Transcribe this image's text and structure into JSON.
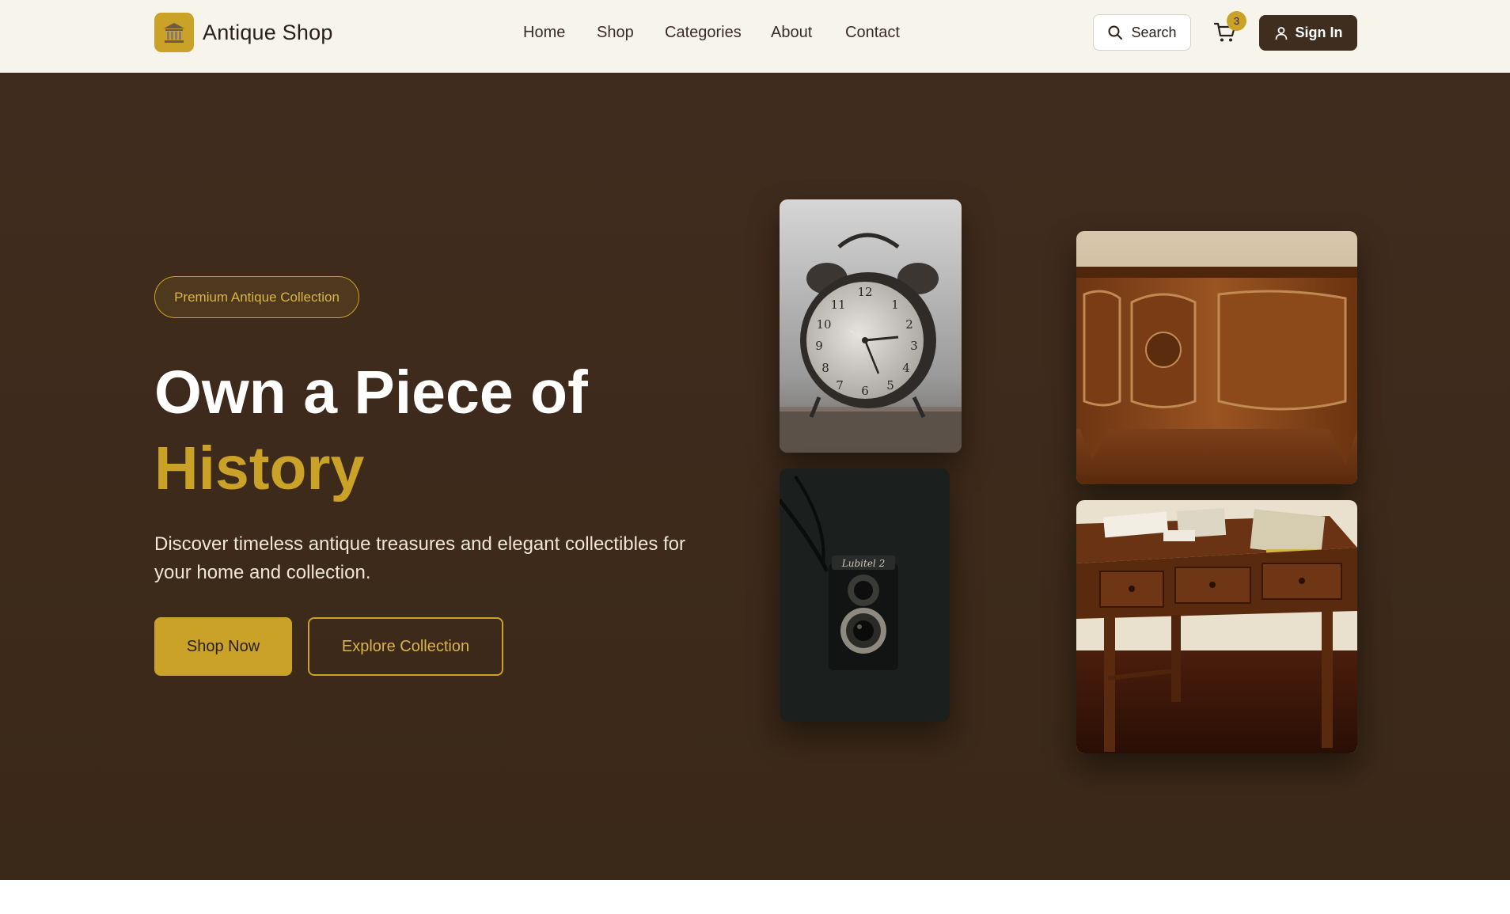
{
  "header": {
    "brand_name": "Antique Shop",
    "brand_icon": "museum-icon",
    "nav": [
      {
        "label": "Home"
      },
      {
        "label": "Shop"
      },
      {
        "label": "Categories"
      },
      {
        "label": "About"
      },
      {
        "label": "Contact"
      }
    ],
    "search_label": "Search",
    "cart_count": "3",
    "signin_label": "Sign In"
  },
  "hero": {
    "badge": "Premium Antique Collection",
    "headline": "Own a Piece of",
    "headline_accent": "History",
    "subtext": "Discover timeless antique treasures and elegant collectibles for your home and collection.",
    "primary_button": "Shop Now",
    "secondary_button": "Explore Collection",
    "images": [
      {
        "subject": "antique alarm clock"
      },
      {
        "subject": "vintage twin-lens camera",
        "text": "Lubitel 2"
      },
      {
        "subject": "carved wooden chest"
      },
      {
        "subject": "antique wooden desk"
      }
    ]
  },
  "colors": {
    "accent": "#c9a227",
    "hero_background": "#3d2a1b",
    "header_background": "#f7f4ec",
    "signin_background": "#3f2d1f"
  }
}
